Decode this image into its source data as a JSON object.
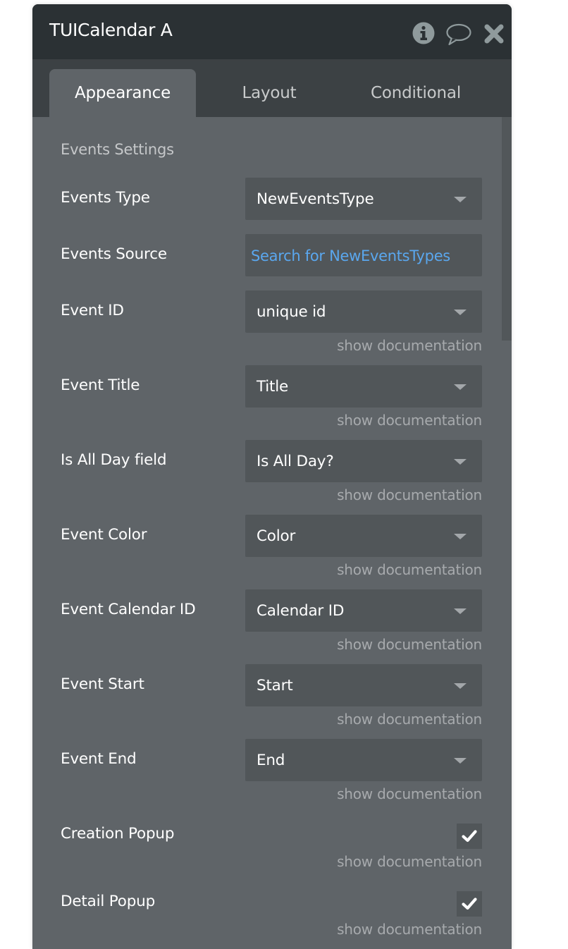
{
  "window": {
    "title": "TUICalendar A",
    "icons": [
      "info-icon",
      "comment-icon",
      "close-icon"
    ]
  },
  "tabs": [
    {
      "label": "Appearance",
      "active": true
    },
    {
      "label": "Layout",
      "active": false
    },
    {
      "label": "Conditional",
      "active": false
    }
  ],
  "section_title": "Events Settings",
  "fields": {
    "events_type": {
      "label": "Events Type",
      "value": "NewEventsType"
    },
    "events_source": {
      "label": "Events Source",
      "value": "Search for NewEventsTypes"
    },
    "event_id": {
      "label": "Event ID",
      "value": "unique id"
    },
    "event_title": {
      "label": "Event Title",
      "value": "Title"
    },
    "is_all_day": {
      "label": "Is All Day field",
      "value": "Is All Day?"
    },
    "event_color": {
      "label": "Event Color",
      "value": "Color"
    },
    "event_calendar_id": {
      "label": "Event Calendar ID",
      "value": "Calendar ID"
    },
    "event_start": {
      "label": "Event Start",
      "value": "Start"
    },
    "event_end": {
      "label": "Event End",
      "value": "End"
    },
    "creation_popup": {
      "label": "Creation Popup",
      "checked": true
    },
    "detail_popup": {
      "label": "Detail Popup",
      "checked": true
    }
  },
  "doc_link": "show documentation",
  "colors": {
    "header_bg": "#2b3134",
    "tabbar_bg": "#3c4144",
    "panel_bg": "#5f6468",
    "input_bg": "#515659",
    "link": "#5aa7ee"
  }
}
